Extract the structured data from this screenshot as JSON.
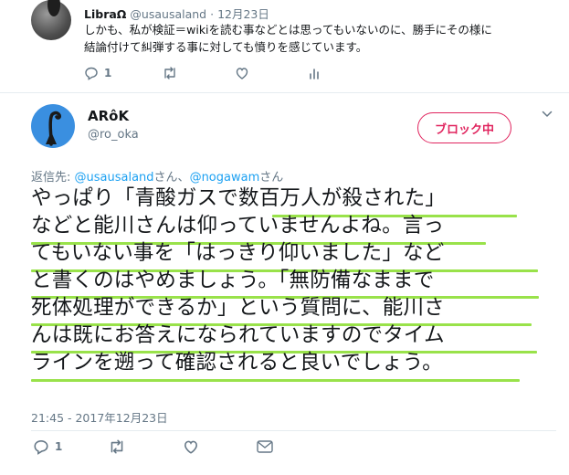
{
  "top_tweet": {
    "display_name": "LibraΩ",
    "handle": "@usausaland",
    "separator": "·",
    "date": "12月23日",
    "body_line1": "しかも、私が検証＝wikiを読む事などとは思ってもいないのに、勝手にその様に",
    "body_line2": "結論付けて糾弾する事に対しても憤りを感じています。",
    "reply_count": "1",
    "retweet_count": "",
    "like_count": ""
  },
  "main_tweet": {
    "display_name": "ARôK",
    "handle": "@ro_oka",
    "block_button_label": "ブロック中",
    "reply_to_prefix": "返信先: ",
    "reply_to_user1": "@usausaland",
    "reply_to_mid": "さん、",
    "reply_to_user2": "@nogawam",
    "reply_to_suffix": "さん",
    "text_lines": [
      "やっぱり「青酸ガスで数百万人が殺された」",
      "などと能川さんは仰っていませんよね。言っ",
      "てもいない事を「はっきり仰いました」など",
      "と書くのはやめましょう。「無防備なままで",
      "死体処理ができるか」という質問に、能川さ",
      "んは既にお答えになられていますのでタイム",
      "ラインを遡って確認されると良いでしょう。"
    ],
    "timestamp": "21:45 - 2017年12月23日",
    "reply_count": "1",
    "retweet_count": "",
    "like_count": ""
  },
  "colors": {
    "accent": "#1da1f2",
    "block": "#e0245e",
    "highlight": "#99e24a",
    "muted": "#657786"
  },
  "icons": [
    "reply-icon",
    "retweet-icon",
    "like-icon",
    "analytics-icon",
    "message-icon",
    "chevron-down-icon"
  ]
}
